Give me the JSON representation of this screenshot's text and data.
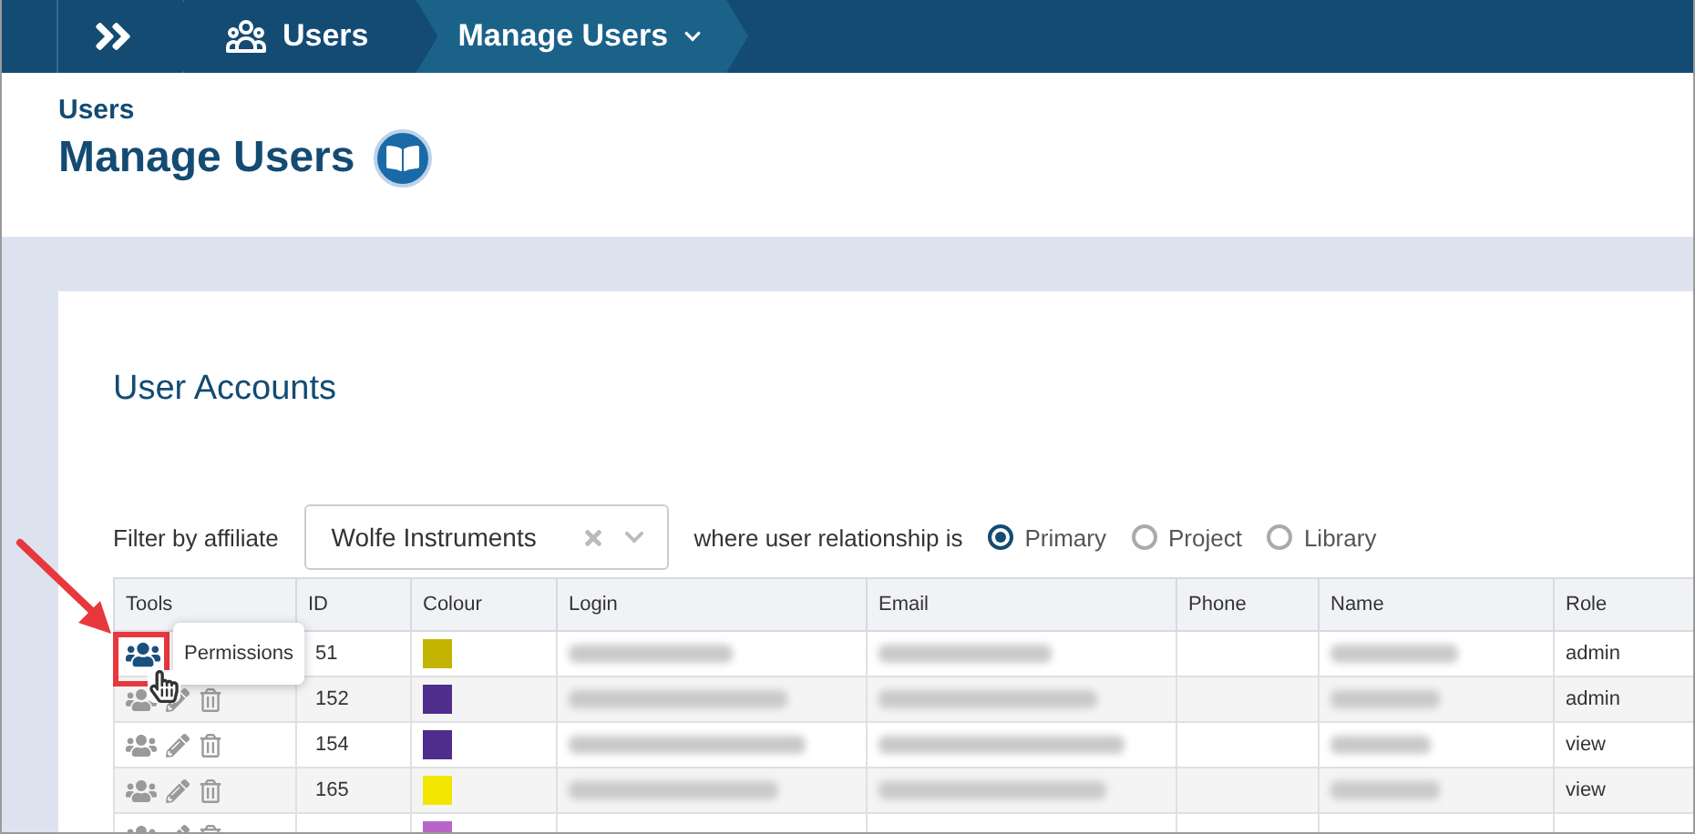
{
  "breadcrumb": {
    "items": [
      {
        "label": "Users",
        "selected": false
      },
      {
        "label": "Manage Users",
        "selected": true
      }
    ]
  },
  "header": {
    "section": "Users",
    "title": "Manage Users"
  },
  "card": {
    "title": "User Accounts"
  },
  "filter": {
    "label": "Filter by affiliate",
    "value": "Wolfe Instruments",
    "relation_label": "where user relationship is",
    "options": [
      {
        "label": "Primary",
        "selected": true
      },
      {
        "label": "Project",
        "selected": false
      },
      {
        "label": "Library",
        "selected": false
      }
    ]
  },
  "table": {
    "columns": [
      "Tools",
      "ID",
      "Colour",
      "Login",
      "Email",
      "Phone",
      "Name",
      "Role"
    ],
    "rows": [
      {
        "id": "51",
        "color": "#c2b400",
        "role": "admin",
        "hovered": true
      },
      {
        "id": "152",
        "color": "#4e2d8c",
        "role": "admin",
        "hovered": false
      },
      {
        "id": "154",
        "color": "#4e2d8c",
        "role": "view",
        "hovered": false
      },
      {
        "id": "165",
        "color": "#f2e600",
        "role": "view",
        "hovered": false
      },
      {
        "color": "#b865c8",
        "hovered": false
      }
    ]
  },
  "tooltip": {
    "text": "Permissions"
  }
}
